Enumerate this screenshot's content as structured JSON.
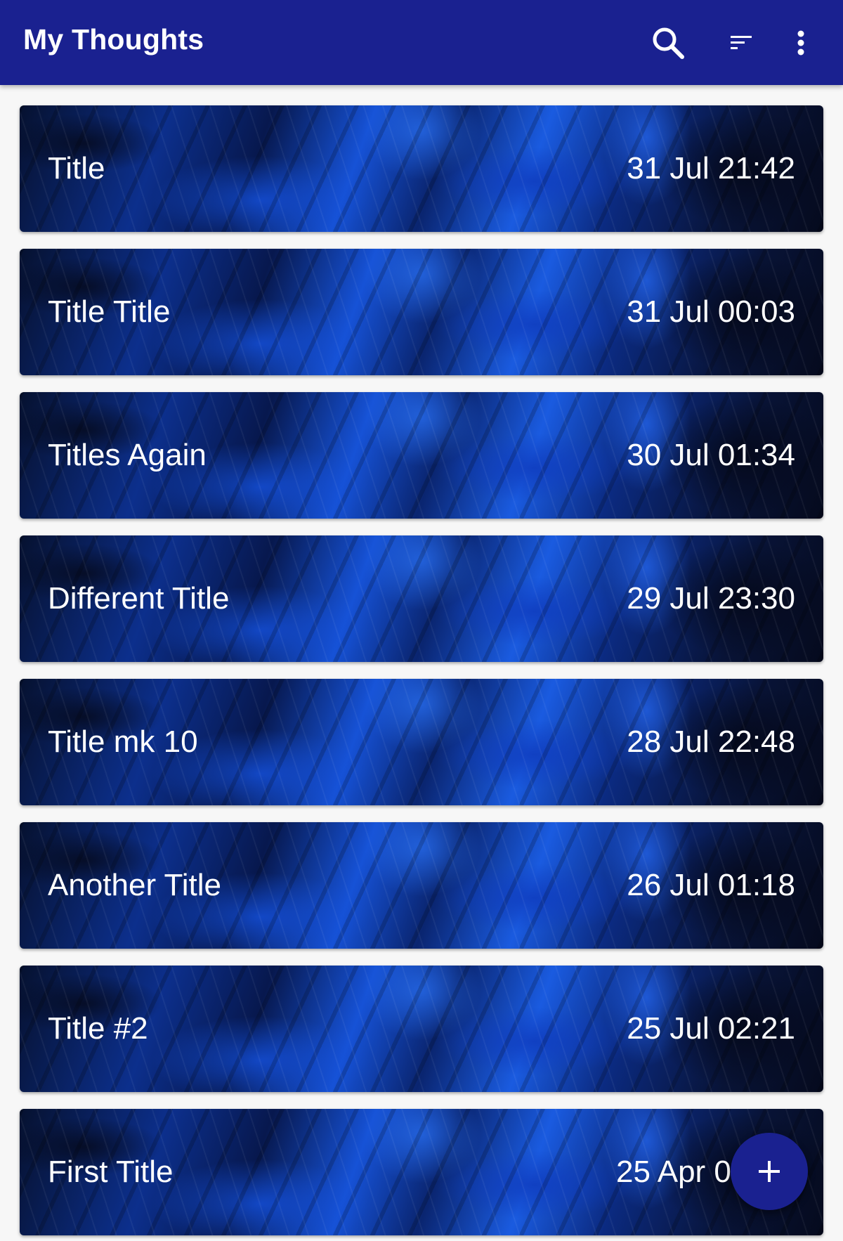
{
  "app_bar": {
    "title": "My Thoughts",
    "color": "#1a2190",
    "actions": [
      {
        "icon": "search-icon",
        "label": "Search"
      },
      {
        "icon": "sort-icon",
        "label": "Sort"
      },
      {
        "icon": "more-vert-icon",
        "label": "More options"
      }
    ]
  },
  "notes": [
    {
      "title": "Title",
      "date": "31 Jul  21:42"
    },
    {
      "title": "Title Title",
      "date": "31 Jul  00:03"
    },
    {
      "title": "Titles Again",
      "date": "30 Jul  01:34"
    },
    {
      "title": "Different Title",
      "date": "29 Jul  23:30"
    },
    {
      "title": "Title mk 10",
      "date": "28 Jul  22:48"
    },
    {
      "title": "Another Title",
      "date": "26 Jul  01:18"
    },
    {
      "title": "Title #2",
      "date": "25 Jul  02:21"
    },
    {
      "title": "First Title",
      "date": "25 Apr  0"
    }
  ],
  "fab": {
    "icon": "plus-icon",
    "color": "#1a2190"
  }
}
